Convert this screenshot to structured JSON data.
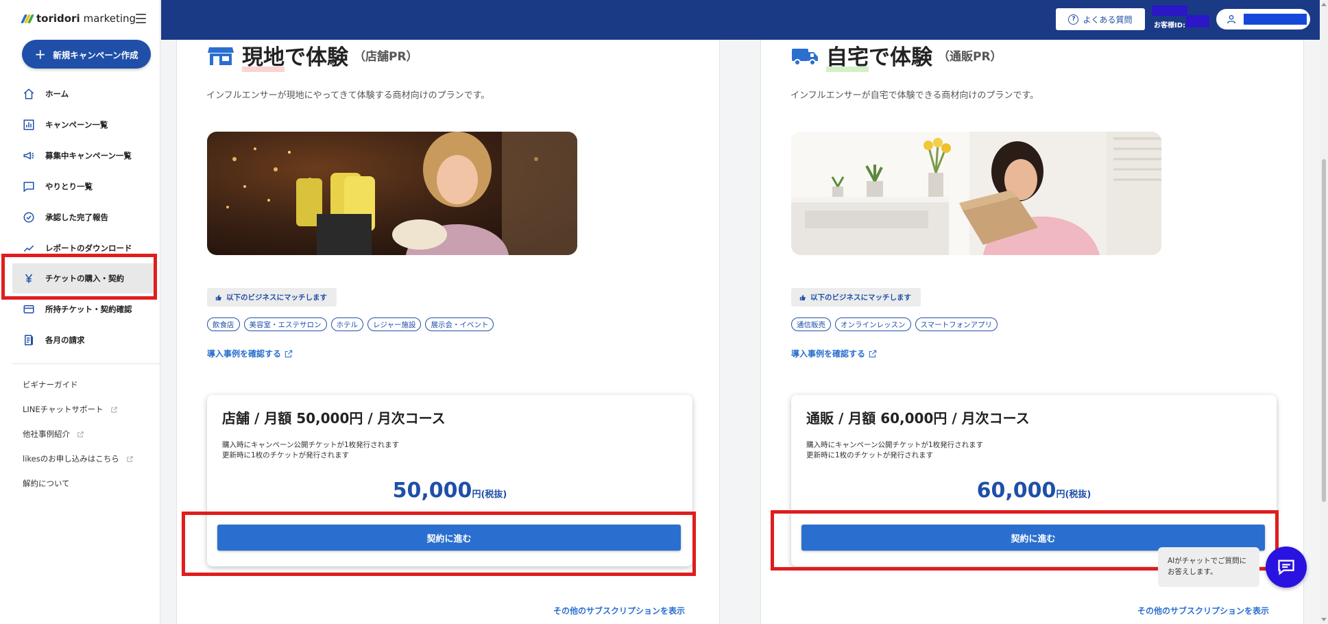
{
  "app": {
    "logo_bold": "toridori",
    "logo_text": " marketing"
  },
  "sidebar": {
    "new_campaign": "新規キャンペーン作成",
    "items": [
      {
        "label": "ホーム",
        "icon": "home-icon"
      },
      {
        "label": "キャンペーン一覧",
        "icon": "chart-icon"
      },
      {
        "label": "募集中キャンペーン一覧",
        "icon": "megaphone-icon"
      },
      {
        "label": "やりとり一覧",
        "icon": "chat-icon"
      },
      {
        "label": "承認した完了報告",
        "icon": "check-circle-icon"
      },
      {
        "label": "レポートのダウンロード",
        "icon": "trend-icon"
      },
      {
        "label": "チケットの購入・契約",
        "icon": "yen-icon",
        "active": true
      },
      {
        "label": "所持チケット・契約確認",
        "icon": "card-icon"
      },
      {
        "label": "各月の請求",
        "icon": "receipt-icon"
      }
    ],
    "sub_items": [
      {
        "label": "ビギナーガイド",
        "external": false
      },
      {
        "label": "LINEチャットサポート",
        "external": true
      },
      {
        "label": "他社事例紹介",
        "external": true
      },
      {
        "label": "likesのお申し込みはこちら",
        "external": true
      },
      {
        "label": "解約について",
        "external": false
      }
    ]
  },
  "topbar": {
    "faq": "よくある質問",
    "customer_id_label": "お客様ID:"
  },
  "plans": [
    {
      "title_main": "現地で体験",
      "title_sub": "（店舗PR）",
      "description": "インフルエンサーが現地にやってきて体験する商材向けのプランです。",
      "match_label": "以下のビジネスにマッチします",
      "tags": [
        "飲食店",
        "美容室・エステサロン",
        "ホテル",
        "レジャー施設",
        "展示会・イベント"
      ],
      "case_link": "導入事例を確認する",
      "card_title": "店舗 / 月額 50,000円 / 月次コース",
      "note_1": "購入時にキャンペーン公開チケットが1枚発行されます",
      "note_2": "更新時に1枚のチケットが発行されます",
      "price": "50,000",
      "price_unit": "円(税抜)",
      "contract_btn": "契約に進む",
      "more": "その他のサブスクリプションを表示"
    },
    {
      "title_main": "自宅で体験",
      "title_sub": "（通販PR）",
      "description": "インフルエンサーが自宅で体験できる商材向けのプランです。",
      "match_label": "以下のビジネスにマッチします",
      "tags": [
        "通信販売",
        "オンラインレッスン",
        "スマートフォンアプリ"
      ],
      "case_link": "導入事例を確認する",
      "card_title": "通販 / 月額 60,000円 / 月次コース",
      "note_1": "購入時にキャンペーン公開チケットが1枚発行されます",
      "note_2": "更新時に1枚のチケットが発行されます",
      "price": "60,000",
      "price_unit": "円(税抜)",
      "contract_btn": "契約に進む",
      "more": "その他のサブスクリプションを表示"
    }
  ],
  "ai_chat": {
    "line1": "AIがチャットでご質問に",
    "line2": "お答えします。"
  },
  "colors": {
    "brand": "#1b3a86",
    "accent": "#2a6fcf",
    "annotation": "#e01d1d",
    "chat": "#2a13e0"
  }
}
